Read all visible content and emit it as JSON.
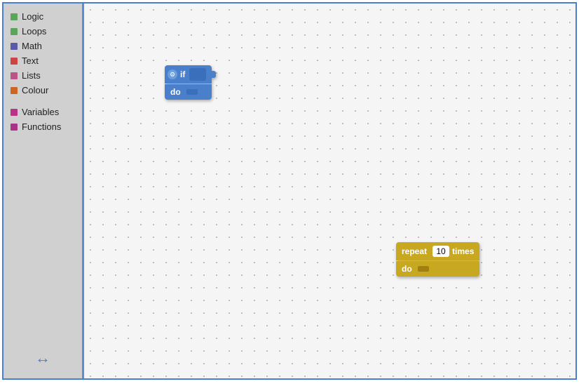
{
  "sidebar": {
    "items": [
      {
        "label": "Logic",
        "color": "#5ba55b"
      },
      {
        "label": "Loops",
        "color": "#5ba55b"
      },
      {
        "label": "Math",
        "color": "#5a5aaa"
      },
      {
        "label": "Text",
        "color": "#cc4444"
      },
      {
        "label": "Lists",
        "color": "#bb5588"
      },
      {
        "label": "Colour",
        "color": "#cc6622"
      }
    ],
    "items2": [
      {
        "label": "Variables",
        "color": "#bb3388"
      },
      {
        "label": "Functions",
        "color": "#aa3388"
      }
    ]
  },
  "if_block": {
    "if_label": "if",
    "do_label": "do",
    "gear_symbol": "⚙"
  },
  "repeat_block": {
    "repeat_label": "repeat",
    "number": "10",
    "times_label": "times",
    "do_label": "do"
  },
  "arrow": "↔"
}
